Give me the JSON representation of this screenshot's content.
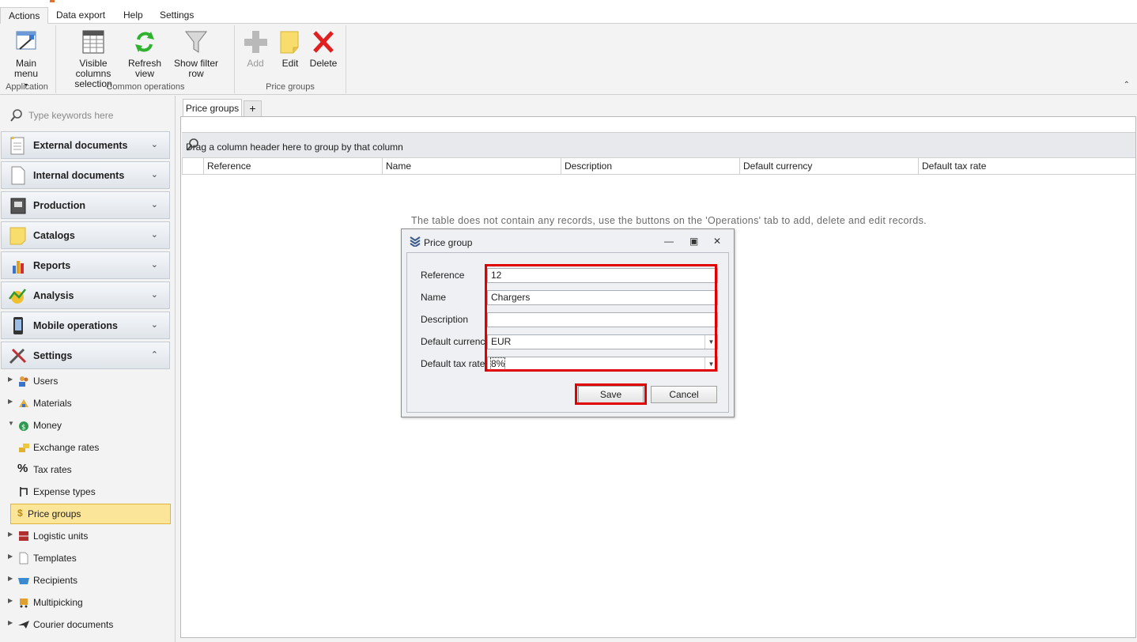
{
  "ribbon_tabs": [
    "Actions",
    "Data export",
    "Help",
    "Settings"
  ],
  "ribbon": {
    "main_menu": "Main menu",
    "visible_columns_line1": "Visible columns",
    "visible_columns_line2": "selection",
    "refresh_line1": "Refresh",
    "refresh_line2": "view",
    "show_filter_row": "Show filter row",
    "add": "Add",
    "edit": "Edit",
    "delete": "Delete",
    "group_application": "Application",
    "group_common": "Common operations",
    "group_price_groups": "Price groups"
  },
  "nav": {
    "search_placeholder": "Type keywords here",
    "groups": [
      {
        "label": "External documents",
        "icon": "document-new-icon"
      },
      {
        "label": "Internal documents",
        "icon": "document-blank-icon"
      },
      {
        "label": "Production",
        "icon": "machine-icon"
      },
      {
        "label": "Catalogs",
        "icon": "sticky-note-icon"
      },
      {
        "label": "Reports",
        "icon": "bar-chart-icon"
      },
      {
        "label": "Analysis",
        "icon": "analysis-icon"
      },
      {
        "label": "Mobile operations",
        "icon": "mobile-phone-icon"
      },
      {
        "label": "Settings",
        "icon": "tools-icon"
      }
    ],
    "settings_items": [
      {
        "label": "Users",
        "icon": "users-icon"
      },
      {
        "label": "Materials",
        "icon": "materials-icon"
      },
      {
        "label": "Money",
        "icon": "money-bag-icon"
      },
      {
        "label": "Exchange rates",
        "icon": "coins-icon"
      },
      {
        "label": "Tax rates",
        "icon": "percent-icon"
      },
      {
        "label": "Expense types",
        "icon": "expense-icon"
      },
      {
        "label": "Price groups",
        "icon": "dollar-icon"
      },
      {
        "label": "Logistic units",
        "icon": "logistic-icon"
      },
      {
        "label": "Templates",
        "icon": "template-icon"
      },
      {
        "label": "Recipients",
        "icon": "basket-icon"
      },
      {
        "label": "Multipicking",
        "icon": "cart-icon"
      },
      {
        "label": "Courier documents",
        "icon": "plane-icon"
      }
    ]
  },
  "content": {
    "tab_label": "Price groups",
    "add_tab": "+",
    "group_hint": "Drag a column header here to group by that column",
    "columns": [
      "Reference",
      "Name",
      "Description",
      "Default currency",
      "Default tax rate"
    ],
    "empty_message": "The table does not contain any records, use the buttons on the 'Operations' tab to add, delete and edit records."
  },
  "dialog": {
    "title": "Price group",
    "fields": [
      {
        "label": "Reference",
        "value": "12"
      },
      {
        "label": "Name",
        "value": "Chargers"
      },
      {
        "label": "Description",
        "value": ""
      },
      {
        "label": "Default currency",
        "value": "EUR"
      },
      {
        "label": "Default tax rate",
        "value": "8%"
      }
    ],
    "save": "Save",
    "cancel": "Cancel"
  },
  "colors": {
    "highlight_red": "#e00000",
    "selected_item_bg": "#fbe598"
  }
}
